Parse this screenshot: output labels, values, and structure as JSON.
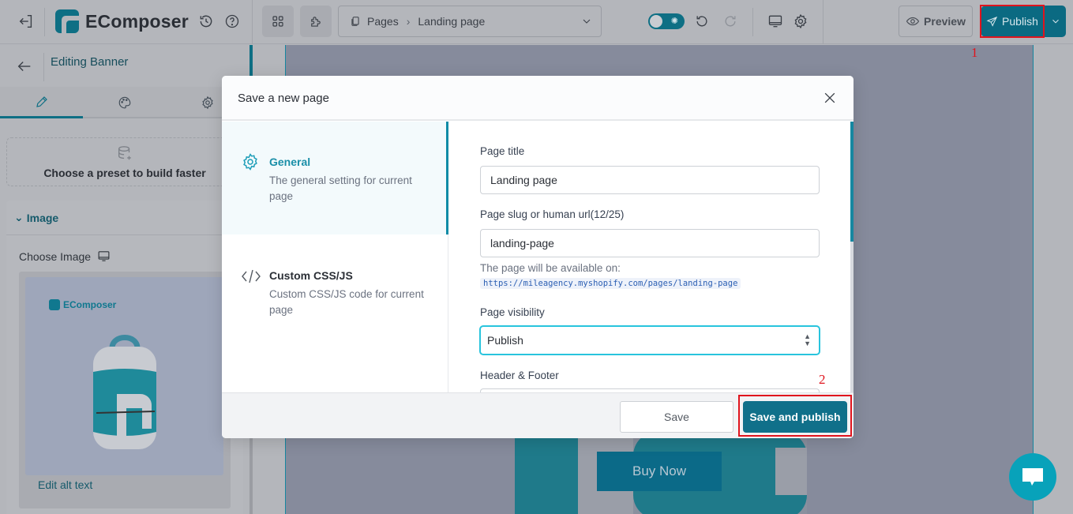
{
  "app": {
    "name": "EComposer",
    "breadcrumb": {
      "section": "Pages",
      "page": "Landing page"
    },
    "toolbar": {
      "preview_label": "Preview",
      "publish_label": "Publish"
    }
  },
  "sidebar": {
    "title": "Editing Banner",
    "tabs": [
      {
        "icon": "pencil-icon",
        "active": true
      },
      {
        "icon": "palette-icon",
        "active": false
      },
      {
        "icon": "gear-icon",
        "active": false
      }
    ],
    "preset_label": "Choose a preset to build faster",
    "image_section": {
      "heading": "Image",
      "choose_label": "Choose Image",
      "preview_brand": "EComposer",
      "edit_alt_label": "Edit alt text"
    }
  },
  "canvas": {
    "buy_now_label": "Buy Now"
  },
  "modal": {
    "title": "Save a new page",
    "nav": [
      {
        "title": "General",
        "description": "The general setting for current page",
        "active": true
      },
      {
        "title": "Custom CSS/JS",
        "description": "Custom CSS/JS code for current page",
        "active": false
      }
    ],
    "fields": {
      "page_title_label": "Page title",
      "page_title_value": "Landing page",
      "slug_label": "Page slug or human url(12/25)",
      "slug_value": "landing-page",
      "availability_text": "The page will be available on:",
      "page_url": "https://mileagency.myshopify.com/pages/landing-page",
      "visibility_label": "Page visibility",
      "visibility_value": "Publish",
      "header_footer_label": "Header & Footer"
    },
    "footer": {
      "save_label": "Save",
      "save_publish_label": "Save and publish"
    }
  },
  "annotations": [
    {
      "number": "1",
      "target": "Publish",
      "color": "#e0141d"
    },
    {
      "number": "2",
      "target": "Save and publish",
      "color": "#e0141d"
    }
  ],
  "colors": {
    "brand": "#0e6f84",
    "focus": "#29c4dd",
    "annotation": "#e0141d"
  }
}
